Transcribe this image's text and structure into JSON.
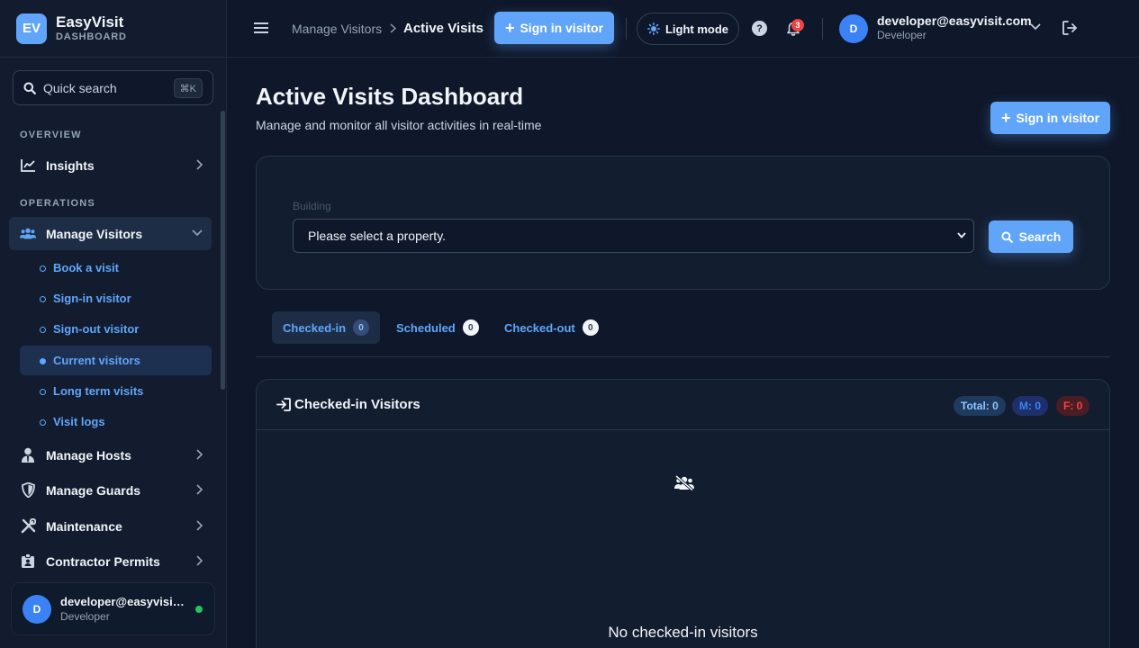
{
  "brand": {
    "logo": "EV",
    "name": "EasyVisit",
    "subtitle": "DASHBOARD"
  },
  "sidebar": {
    "search": {
      "placeholder": "Quick search",
      "shortcut": "⌘K"
    },
    "sections": {
      "overview": "OVERVIEW",
      "operations": "OPERATIONS"
    },
    "items": {
      "insights": "Insights",
      "manage_visitors": "Manage Visitors",
      "manage_hosts": "Manage Hosts",
      "manage_guards": "Manage Guards",
      "maintenance": "Maintenance",
      "contractor_permits": "Contractor Permits"
    },
    "sub_items": {
      "book_visit": "Book a visit",
      "sign_in_visitor": "Sign-in visitor",
      "sign_out_visitor": "Sign-out visitor",
      "current_visitors": "Current visitors",
      "long_term_visits": "Long term visits",
      "visit_logs": "Visit logs"
    },
    "user": {
      "initial": "D",
      "email": "developer@easyvisit.com",
      "role": "Developer"
    }
  },
  "topbar": {
    "breadcrumb": {
      "parent": "Manage Visitors",
      "current": "Active Visits"
    },
    "sign_in_label": "Sign in visitor",
    "light_mode_label": "Light mode",
    "help_glyph": "?",
    "notification_count": "3",
    "user": {
      "initial": "D",
      "email": "developer@easyvisit.com",
      "role": "Developer"
    }
  },
  "main": {
    "title": "Active Visits Dashboard",
    "subtitle": "Manage and monitor all visitor activities in real-time",
    "sign_in_label": "Sign in visitor",
    "filter": {
      "label": "Building",
      "selected": "Please select a property.",
      "search_label": "Search"
    },
    "tabs": {
      "checked_in": {
        "label": "Checked-in",
        "count": "0"
      },
      "scheduled": {
        "label": "Scheduled",
        "count": "0"
      },
      "checked_out": {
        "label": "Checked-out",
        "count": "0"
      }
    },
    "list": {
      "title": "Checked-in Visitors",
      "total": "Total: 0",
      "male": "M: 0",
      "female": "F: 0",
      "empty_text": "No checked-in visitors"
    }
  },
  "colors": {
    "accent": "#60a5fa",
    "background": "#0f172a",
    "sidebar": "#121c2e",
    "danger": "#ef4444",
    "online": "#22c55e"
  }
}
